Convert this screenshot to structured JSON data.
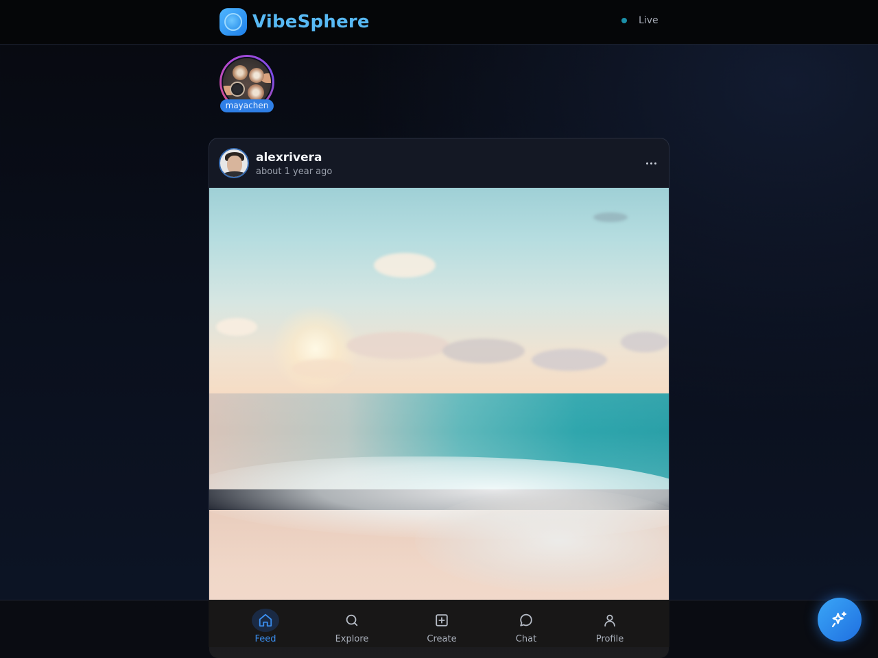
{
  "header": {
    "brand_name": "VibeSphere",
    "status_label": "Live"
  },
  "stories": [
    {
      "username": "mayachen"
    }
  ],
  "post": {
    "username": "alexrivera",
    "timestamp": "about 1 year ago"
  },
  "bottom_nav": {
    "items": [
      {
        "label": "Feed",
        "icon": "home-icon",
        "active": true
      },
      {
        "label": "Explore",
        "icon": "search-icon",
        "active": false
      },
      {
        "label": "Create",
        "icon": "plus-square-icon",
        "active": false
      },
      {
        "label": "Chat",
        "icon": "chat-bubble-icon",
        "active": false
      },
      {
        "label": "Profile",
        "icon": "user-icon",
        "active": false
      }
    ]
  },
  "fab": {
    "icon": "sparkles-icon"
  },
  "colors": {
    "accent": "#3b8ff0",
    "brand": "#58b9f4",
    "live_dot": "#1b8fa8",
    "story_badge": "#2f7fe6"
  }
}
